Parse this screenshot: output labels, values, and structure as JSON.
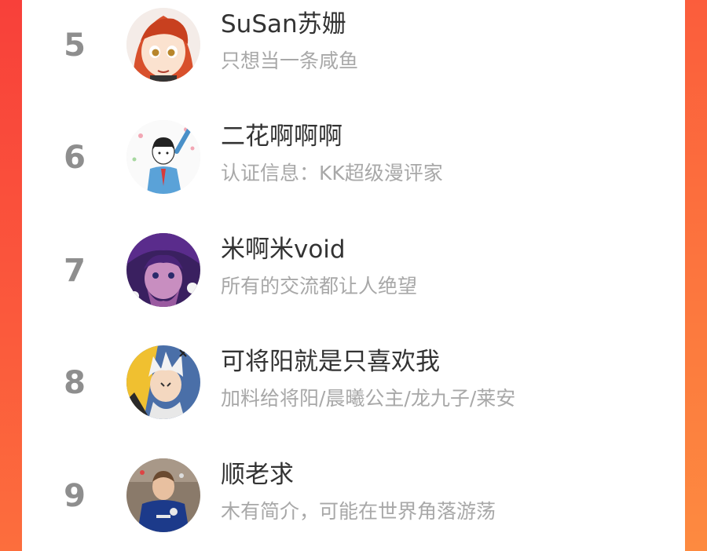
{
  "ranking": {
    "items": [
      {
        "rank": "5",
        "name": "SuSan苏姗",
        "bio": "只想当一条咸鱼",
        "avatar_icon": "avatar-anime-girl-red-hair"
      },
      {
        "rank": "6",
        "name": "二花啊啊啊",
        "bio": "认证信息：KK超级漫评家",
        "avatar_icon": "avatar-sketch-schoolgirl"
      },
      {
        "rank": "7",
        "name": "米啊米void",
        "bio": "所有的交流都让人绝望",
        "avatar_icon": "avatar-purple-hair-character"
      },
      {
        "rank": "8",
        "name": "可将阳就是只喜欢我",
        "bio": "加料给将阳/晨曦公主/龙九子/莱安",
        "avatar_icon": "avatar-anime-boy-white-hair"
      },
      {
        "rank": "9",
        "name": "顺老求",
        "bio": "木有简介，可能在世界角落游荡",
        "avatar_icon": "avatar-football-player"
      }
    ]
  },
  "colors": {
    "background_accent": "#fb5a3c",
    "rank_text": "#8e8e8e",
    "name_text": "#333333",
    "bio_text": "#a8a8a8"
  }
}
